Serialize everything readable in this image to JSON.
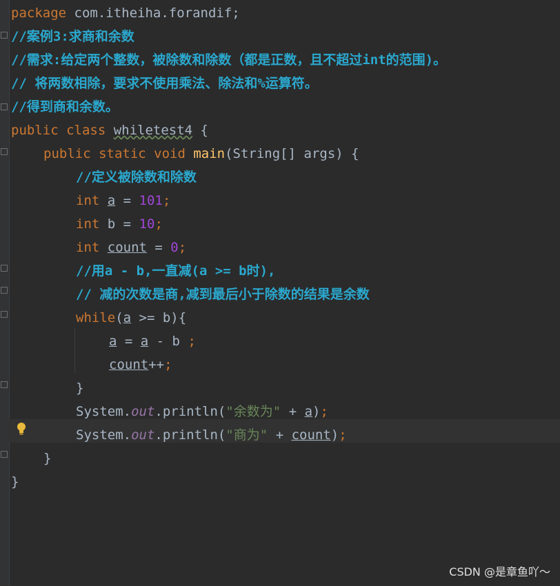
{
  "code": {
    "l1_kw": "package",
    "l1_rest": " com.itheiha.forandif;",
    "l2": "//案例3:求商和余数",
    "l3": "//需求:给定两个整数，被除数和除数（都是正数，且不超过int的范围)。",
    "l4": "// 将两数相除，要求不使用乘法、除法和%运算符。",
    "l5": "//得到商和余数。",
    "l6_kw": "public class ",
    "l6_name": "whiletest4",
    "l6_rest": " {",
    "l7_kw1": "public static void ",
    "l7_fn": "main",
    "l7_rest": "(String[] args) {",
    "l8": "//定义被除数和除数",
    "l9_kw": "int ",
    "l9_var": "a",
    "l9_op": " = ",
    "l9_num": "101",
    "l9_semi": ";",
    "l10_kw": "int ",
    "l10_var": "b",
    "l10_op": " = ",
    "l10_num": "10",
    "l10_semi": ";",
    "l11_kw": "int ",
    "l11_var": "count",
    "l11_op": " = ",
    "l11_num": "0",
    "l11_semi": ";",
    "l12": "//用a - b,一直减(a >= b时),",
    "l13": "// 减的次数是商,减到最后小于除数的结果是余数",
    "l14_kw": "while",
    "l14_p1": "(",
    "l14_var": "a",
    "l14_rest": " >= b){",
    "l15_v1": "a",
    "l15_op": " = ",
    "l15_v2": "a",
    "l15_rest": " - b ",
    "l15_semi": ";",
    "l16_var": "count",
    "l16_rest": "++",
    "l16_semi": ";",
    "l17": "}",
    "l18_a": "System.",
    "l18_out": "out",
    "l18_b": ".println(",
    "l18_str": "\"余数为\"",
    "l18_c": " + ",
    "l18_var": "a",
    "l18_d": ")",
    "l18_semi": ";",
    "l19_a": "System.",
    "l19_out": "out",
    "l19_b": ".println(",
    "l19_str": "\"商为\"",
    "l19_c": " + ",
    "l19_var": "count",
    "l19_d": ")",
    "l19_semi": ";",
    "l20": "}",
    "l21": "}"
  },
  "watermark": "CSDN @是章鱼吖～"
}
